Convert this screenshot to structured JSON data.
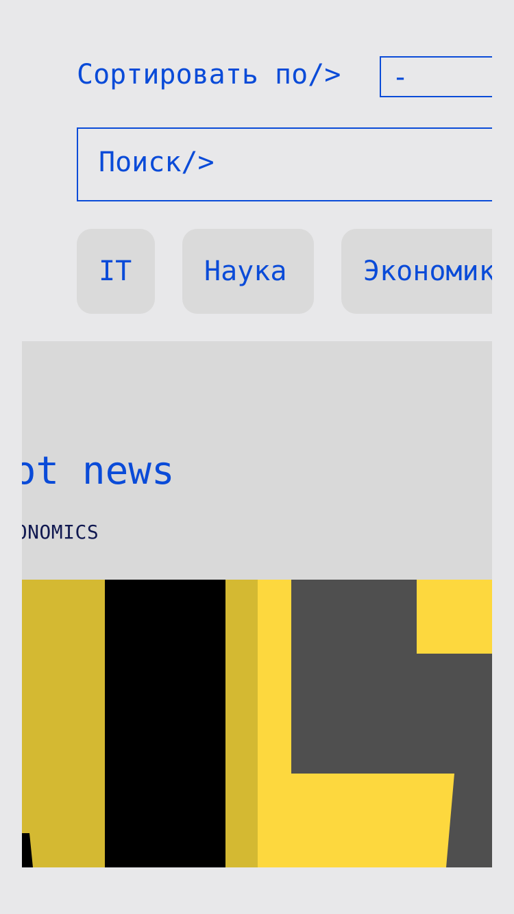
{
  "sort": {
    "label": "Сортировать по/>",
    "value": "-"
  },
  "search": {
    "placeholder": "Поиск/>"
  },
  "categories": [
    {
      "label": "IT"
    },
    {
      "label": "Наука"
    },
    {
      "label": "Экономика"
    }
  ],
  "hot_news": {
    "title": "Hot news",
    "subtitle": "ECONOMICS"
  },
  "colors": {
    "accent": "#0a4bd8",
    "background": "#e8e8ea",
    "chip_bg": "#dadada",
    "card_bg": "#d9d9d9",
    "image_yellow_dark": "#d4b932",
    "image_yellow_light": "#fdd83e",
    "image_gray": "#4f4f4f",
    "image_black": "#000000"
  }
}
